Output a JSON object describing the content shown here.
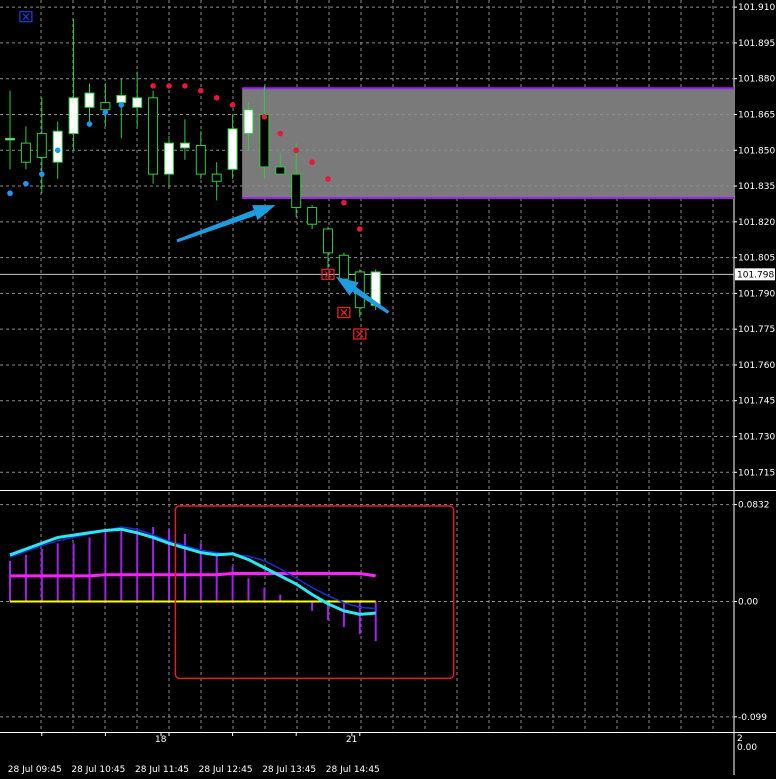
{
  "theme": {
    "bg": "#000000",
    "grid": "#8c8c8c",
    "bull": "#ffffff",
    "bear": "#000000",
    "wick": "#2ecc40"
  },
  "chart_data": [
    {
      "type": "candlestick",
      "title": "",
      "price_axis_ticks": [
        "101.910",
        "101.895",
        "101.880",
        "101.865",
        "101.850",
        "101.835",
        "101.820",
        "101.805",
        "101.790",
        "101.775",
        "101.760",
        "101.745",
        "101.730",
        "101.715"
      ],
      "ylim": [
        101.708,
        101.913
      ],
      "current_price": {
        "label": "101.798",
        "value": 101.798
      },
      "candles": [
        {
          "o": 101.855,
          "h": 101.875,
          "l": 101.842,
          "c": 101.855
        },
        {
          "o": 101.853,
          "h": 101.86,
          "l": 101.842,
          "c": 101.845
        },
        {
          "o": 101.857,
          "h": 101.872,
          "l": 101.832,
          "c": 101.847
        },
        {
          "o": 101.845,
          "h": 101.862,
          "l": 101.838,
          "c": 101.858
        },
        {
          "o": 101.857,
          "h": 101.905,
          "l": 101.85,
          "c": 101.872
        },
        {
          "o": 101.868,
          "h": 101.878,
          "l": 101.86,
          "c": 101.874
        },
        {
          "o": 101.87,
          "h": 101.878,
          "l": 101.86,
          "c": 101.867
        },
        {
          "o": 101.87,
          "h": 101.88,
          "l": 101.855,
          "c": 101.873
        },
        {
          "o": 101.868,
          "h": 101.883,
          "l": 101.86,
          "c": 101.872
        },
        {
          "o": 101.872,
          "h": 101.875,
          "l": 101.836,
          "c": 101.84
        },
        {
          "o": 101.84,
          "h": 101.856,
          "l": 101.835,
          "c": 101.853
        },
        {
          "o": 101.851,
          "h": 101.863,
          "l": 101.846,
          "c": 101.853
        },
        {
          "o": 101.852,
          "h": 101.858,
          "l": 101.838,
          "c": 101.84
        },
        {
          "o": 101.84,
          "h": 101.845,
          "l": 101.829,
          "c": 101.837
        },
        {
          "o": 101.842,
          "h": 101.865,
          "l": 101.838,
          "c": 101.859
        },
        {
          "o": 101.857,
          "h": 101.87,
          "l": 101.85,
          "c": 101.867
        },
        {
          "o": 101.865,
          "h": 101.877,
          "l": 101.838,
          "c": 101.843
        },
        {
          "o": 101.843,
          "h": 101.849,
          "l": 101.84,
          "c": 101.84
        },
        {
          "o": 101.84,
          "h": 101.853,
          "l": 101.822,
          "c": 101.826
        },
        {
          "o": 101.826,
          "h": 101.827,
          "l": 101.817,
          "c": 101.819
        },
        {
          "o": 101.817,
          "h": 101.818,
          "l": 101.8,
          "c": 101.807
        },
        {
          "o": 101.806,
          "h": 101.807,
          "l": 101.793,
          "c": 101.796
        },
        {
          "o": 101.799,
          "h": 101.8,
          "l": 101.78,
          "c": 101.784
        },
        {
          "o": 101.785,
          "h": 101.8,
          "l": 101.783,
          "c": 101.799
        }
      ],
      "sar_dots": [
        {
          "i": 0,
          "v": 101.832,
          "color": "#2196f3"
        },
        {
          "i": 1,
          "v": 101.836,
          "color": "#2196f3"
        },
        {
          "i": 2,
          "v": 101.84,
          "color": "#2196f3"
        },
        {
          "i": 3,
          "v": 101.85,
          "color": "#2196f3"
        },
        {
          "i": 5,
          "v": 101.861,
          "color": "#2196f3"
        },
        {
          "i": 6,
          "v": 101.866,
          "color": "#2196f3"
        },
        {
          "i": 7,
          "v": 101.869,
          "color": "#2196f3"
        },
        {
          "i": 9,
          "v": 101.877,
          "color": "#e8173c"
        },
        {
          "i": 10,
          "v": 101.877,
          "color": "#e8173c"
        },
        {
          "i": 11,
          "v": 101.877,
          "color": "#e8173c"
        },
        {
          "i": 12,
          "v": 101.875,
          "color": "#e8173c"
        },
        {
          "i": 13,
          "v": 101.872,
          "color": "#e8173c"
        },
        {
          "i": 14,
          "v": 101.869,
          "color": "#e8173c"
        },
        {
          "i": 16,
          "v": 101.864,
          "color": "#e8173c"
        },
        {
          "i": 17,
          "v": 101.857,
          "color": "#e8173c"
        },
        {
          "i": 18,
          "v": 101.85,
          "color": "#e8173c"
        },
        {
          "i": 19,
          "v": 101.845,
          "color": "#e8173c"
        },
        {
          "i": 20,
          "v": 101.838,
          "color": "#e8173c"
        },
        {
          "i": 21,
          "v": 101.828,
          "color": "#e8173c"
        },
        {
          "i": 22,
          "v": 101.817,
          "color": "#e8173c"
        }
      ],
      "signal_markers": [
        {
          "i": 1,
          "v": 101.906,
          "color": "#1a3ad8"
        },
        {
          "i": 20,
          "v": 101.798,
          "color": "#e01f1f"
        },
        {
          "i": 21,
          "v": 101.782,
          "color": "#e01f1f"
        },
        {
          "i": 22,
          "v": 101.773,
          "color": "#e01f1f"
        }
      ],
      "zone": {
        "from_index": 14.6,
        "to_value_top": 101.876,
        "to_value_bottom": 101.83,
        "fill": "#7a7a7a",
        "edge": "#a020f0"
      },
      "arrows": [
        {
          "from_i": 10.5,
          "from_v": 101.812,
          "to_i": 16.7,
          "to_v": 101.827,
          "color": "#1e9ce0"
        },
        {
          "from_i": 23.8,
          "from_v": 101.782,
          "to_i": 20.5,
          "to_v": 101.797,
          "color": "#1e9ce0"
        }
      ]
    },
    {
      "type": "oscillator",
      "ticks": [
        "0.0832",
        "0.00",
        "-0.099"
      ],
      "ylim": [
        -0.112,
        0.094
      ],
      "zero_label": "0.00",
      "histogram": [
        0.035,
        0.04,
        0.045,
        0.05,
        0.05,
        0.055,
        0.06,
        0.062,
        0.063,
        0.064,
        0.062,
        0.058,
        0.05,
        0.04,
        0.03,
        0.02,
        0.012,
        0.006,
        0.001,
        -0.008,
        -0.016,
        -0.022,
        -0.028,
        -0.034
      ],
      "main_line": [
        0.04,
        0.045,
        0.05,
        0.055,
        0.057,
        0.059,
        0.061,
        0.062,
        0.059,
        0.055,
        0.05,
        0.046,
        0.042,
        0.04,
        0.041,
        0.036,
        0.029,
        0.022,
        0.015,
        0.006,
        -0.002,
        -0.008,
        -0.011,
        -0.01
      ],
      "signal_line": [
        0.038,
        0.043,
        0.048,
        0.052,
        0.055,
        0.058,
        0.061,
        0.064,
        0.062,
        0.057,
        0.052,
        0.048,
        0.044,
        0.042,
        0.04,
        0.039,
        0.035,
        0.028,
        0.02,
        0.012,
        0.005,
        -0.001,
        -0.005,
        -0.006
      ],
      "level_line": [
        0.022,
        0.022,
        0.022,
        0.022,
        0.022,
        0.022,
        0.023,
        0.023,
        0.023,
        0.023,
        0.023,
        0.023,
        0.023,
        0.023,
        0.024,
        0.024,
        0.024,
        0.024,
        0.024,
        0.024,
        0.024,
        0.024,
        0.024,
        0.022
      ],
      "zero_line": [
        0.0,
        0.0,
        0.0,
        0.0,
        0.0,
        0.0,
        0.0,
        0.0,
        0.0,
        0.0,
        0.0,
        0.0,
        0.0,
        0.0,
        0.0,
        0.0,
        0.0,
        0.0,
        0.0,
        0.0,
        0.0,
        0.0,
        0.0,
        0.0
      ],
      "colors": {
        "histogram": "#a020f0",
        "main": "#29e7f7",
        "signal": "#1a2fd0",
        "level": "#ff1fff",
        "zero": "#ffff00"
      },
      "highlight_box": {
        "from_i": 10.4,
        "to_i": 27.9,
        "top": 0.082,
        "bottom": -0.066,
        "color": "#e01f1f"
      }
    }
  ],
  "time_axis": {
    "labels": [
      {
        "text": "28 Jul 09:45",
        "i": 2
      },
      {
        "text": "28 Jul 10:45",
        "i": 6
      },
      {
        "text": "28 Jul 11:45",
        "i": 10
      },
      {
        "text": "28 Jul 12:45",
        "i": 14
      },
      {
        "text": "28 Jul 13:45",
        "i": 18
      },
      {
        "text": "28 Jul 14:45",
        "i": 22
      }
    ],
    "day_markers": [
      {
        "text": "18",
        "i": 9.5
      },
      {
        "text": "21",
        "i": 21.5
      }
    ]
  },
  "bottom_right": {
    "line1": "2",
    "line2": "0.00"
  }
}
